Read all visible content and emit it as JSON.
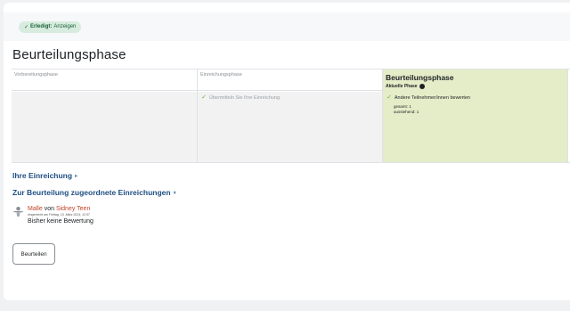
{
  "completion": {
    "status_label": "Erledigt:",
    "status_value": "Anzeigen",
    "check_icon": "check-icon",
    "color": "#d7ecdf"
  },
  "page": {
    "title": "Beurteilungsphase"
  },
  "phases": [
    {
      "name": "Vorbereitungsphase",
      "tasks": []
    },
    {
      "name": "Einreichungsphase",
      "tasks": [
        {
          "label": "Übermitteln Sie Ihre Einreichung",
          "done": true
        }
      ]
    },
    {
      "name": "Beurteilungsphase",
      "current_label": "Aktuelle Phase",
      "tasks": [
        {
          "label": "Andere Teilnehmer/innen bewerten",
          "done": true
        }
      ],
      "details": [
        "gesamt: 1",
        "ausstehend: 1"
      ],
      "color": "#e4edc8"
    }
  ],
  "sections": {
    "own_submission": "Ihre Einreichung",
    "assigned_submissions": "Zur Beurteilung zugeordnete Einreichungen"
  },
  "submission": {
    "title": "Malle",
    "by_label": "von",
    "author": "Sidney Teen",
    "submitted_at": "eingereicht am Freitag, 15. März 2024, 12:57",
    "assessment_status": "Bisher keine Bewertung"
  },
  "actions": {
    "assess_label": "Beurteilen"
  }
}
